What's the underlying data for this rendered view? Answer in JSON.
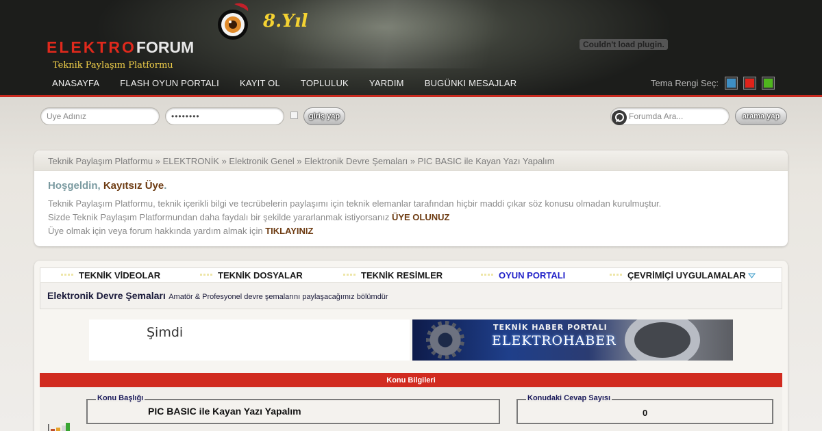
{
  "header": {
    "logo_left": "ELEKTRO",
    "logo_right": "FORUM",
    "tagline": "Teknik Paylaşım Platformu",
    "year_badge": "8.Yıl",
    "plugin_message": "Couldn't load plugin.",
    "nav": [
      "ANASAYFA",
      "FLASH OYUN PORTALI",
      "KAYIT OL",
      "TOPLULUK",
      "YARDIM",
      "BUGÜNKI MESAJLAR"
    ],
    "theme_label": "Tema Rengi Seç:",
    "theme_colors": [
      "#3e8fc4",
      "#e0231a",
      "#4fb51e"
    ]
  },
  "login": {
    "username_placeholder": "Uye Adınız",
    "password_value": "••••••••",
    "login_button": "giriş yap",
    "search_placeholder": "Forumda Ara...",
    "search_button": "arama yap"
  },
  "breadcrumb": "Teknik Paylaşım Platformu » ELEKTRONİK » Elektronik Genel » Elektronik Devre Şemaları » PIC BASIC ile Kayan Yazı Yapalım",
  "welcome": {
    "greeting": "Hoşgeldin,",
    "guest": "Kayıtsız Üye",
    "dot": ".",
    "line1": "Teknik Paylaşım Platformu, teknik içerikli bilgi ve tecrübelerin paylaşımı için teknik elemanlar tarafından hiçbir maddi çıkar söz konusu olmadan kurulmuştur.",
    "line2_text": "Sizde Teknik Paylaşım Platformundan daha faydalı bir şekilde yararlanmak istiyorsanız",
    "line2_link": "ÜYE OLUNUZ",
    "line3_text": "Üye olmak için veya forum hakkında yardım almak için",
    "line3_link": "TIKLAYINIZ"
  },
  "quick_nav": {
    "items": [
      "TEKNİK VİDEOLAR",
      "TEKNİK DOSYALAR",
      "TEKNİK RESİMLER",
      "OYUN PORTALI",
      "ÇEVRİMİÇİ UYGULAMALAR"
    ],
    "highlight_color": "#1e1ec8"
  },
  "forum": {
    "name": "Elektronik Devre Şemaları",
    "description": "Amatör & Profesyonel devre şemalarını paylaşacağımız bölümdür"
  },
  "banners": {
    "left_text": "Şimdi",
    "right_top": "TEKNİK HABER PORTALI",
    "right_main": "ELEKTROHABER"
  },
  "topic_info": {
    "bar_title": "Konu Bilgileri",
    "title_legend": "Konu Başlığı",
    "title_value": "PIC BASIC ile Kayan Yazı Yapalım",
    "replies_legend": "Konudaki Cevap Sayısı",
    "replies_value": "0"
  }
}
